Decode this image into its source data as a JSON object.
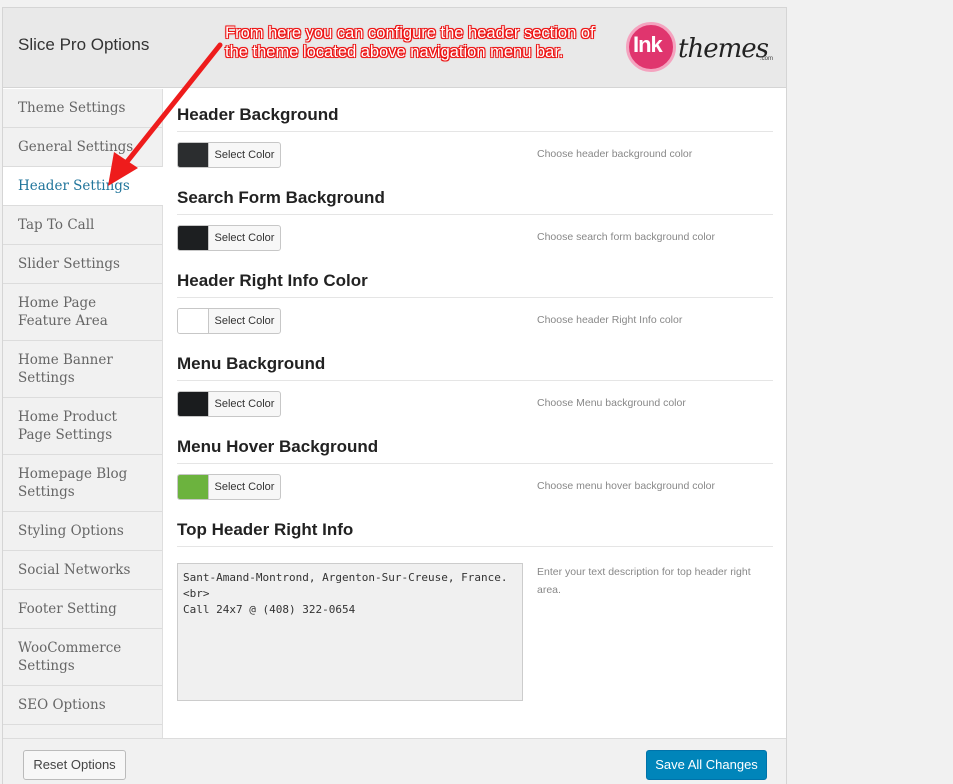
{
  "app": {
    "title": "Slice Pro Options",
    "logo": {
      "ink": "Ink",
      "themes": "themes",
      "com": ".com"
    }
  },
  "annotation": {
    "text": "From here you can configure the header section of the theme located above navigation menu bar.",
    "color": "#e11111"
  },
  "sidebar": {
    "items": [
      {
        "label": "Theme Settings",
        "active": false
      },
      {
        "label": "General Settings",
        "active": false
      },
      {
        "label": "Header Settings",
        "active": true
      },
      {
        "label": "Tap To Call",
        "active": false
      },
      {
        "label": "Slider Settings",
        "active": false
      },
      {
        "label": "Home Page Feature Area",
        "active": false
      },
      {
        "label": "Home Banner Settings",
        "active": false
      },
      {
        "label": "Home Product Page Settings",
        "active": false
      },
      {
        "label": "Homepage Blog Settings",
        "active": false
      },
      {
        "label": "Styling Options",
        "active": false
      },
      {
        "label": "Social Networks",
        "active": false
      },
      {
        "label": "Footer Setting",
        "active": false
      },
      {
        "label": "WooCommerce Settings",
        "active": false
      },
      {
        "label": "SEO Options",
        "active": false
      }
    ]
  },
  "sections": [
    {
      "title": "Header Background",
      "button_label": "Select Color",
      "color": "#2b2d2f",
      "description": "Choose header background color"
    },
    {
      "title": "Search Form Background",
      "button_label": "Select Color",
      "color": "#1d1f21",
      "description": "Choose search form background color"
    },
    {
      "title": "Header Right Info Color",
      "button_label": "Select Color",
      "color": "#ffffff",
      "description": "Choose header Right Info color"
    },
    {
      "title": "Menu Background",
      "button_label": "Select Color",
      "color": "#1a1c1e",
      "description": "Choose Menu background color"
    },
    {
      "title": "Menu Hover Background",
      "button_label": "Select Color",
      "color": "#6cb33e",
      "description": "Choose menu hover background color"
    }
  ],
  "top_header_info": {
    "title": "Top Header Right Info",
    "value": "Sant-Amand-Montrond, Argenton-Sur-Creuse, France.\n<br>\nCall 24x7 @ (408) 322-0654",
    "description": "Enter your text description for top header right area."
  },
  "footer": {
    "reset_label": "Reset Options",
    "save_label": "Save All Changes"
  }
}
